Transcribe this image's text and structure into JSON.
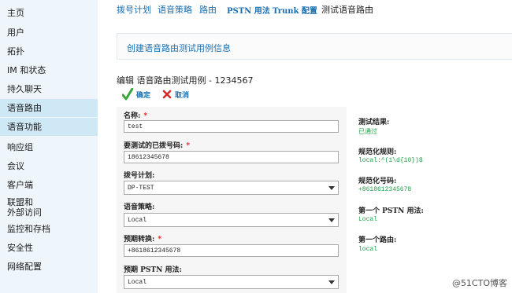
{
  "sidebar": {
    "items": [
      {
        "label": "主页"
      },
      {
        "label": "用户"
      },
      {
        "label": "拓扑"
      },
      {
        "label": "IM 和状态"
      },
      {
        "label": "持久聊天"
      },
      {
        "label": "语音路由"
      },
      {
        "label": "语音功能"
      },
      {
        "label": "响应组"
      },
      {
        "label": "会议"
      },
      {
        "label": "客户端"
      },
      {
        "label": "联盟和",
        "label2": "外部访问"
      },
      {
        "label": "监控和存档"
      },
      {
        "label": "安全性"
      },
      {
        "label": "网络配置"
      }
    ]
  },
  "tabs": [
    {
      "label": "拨号计划"
    },
    {
      "label": "语音策略"
    },
    {
      "label": "路由"
    },
    {
      "label": "PSTN 用法"
    },
    {
      "label": "Trunk 配置"
    },
    {
      "label": "测试语音路由"
    }
  ],
  "info_box": {
    "link": "创建语音路由测试用例信息"
  },
  "edit_title": "编辑 语音路由测试用例 - 1234567",
  "actions": {
    "ok": "确定",
    "cancel": "取消"
  },
  "form": {
    "name": {
      "label": "名称:",
      "required": "*",
      "value": "test"
    },
    "number": {
      "label": "要测试的已拨号码:",
      "required": "*",
      "value": "18612345678"
    },
    "dial_plan": {
      "label": "拨号计划:",
      "value": "DP-TEST"
    },
    "voice_policy": {
      "label": "语音策略:",
      "value": "Local"
    },
    "expected_translation": {
      "label": "预期转换:",
      "required": "*",
      "value": "+8618612345678"
    },
    "expected_pstn": {
      "label": "预期 PSTN 用法:",
      "value": "Local"
    }
  },
  "results": {
    "test_result": {
      "label": "测试结果:",
      "value": "已通过"
    },
    "normalization_rule": {
      "label": "规范化规则:",
      "value": "local:^(1\\d{10})$"
    },
    "normalized_number": {
      "label": "规范化号码:",
      "value": "+8618612345678"
    },
    "first_pstn": {
      "label": "第一个 PSTN 用法:",
      "value": "Local"
    },
    "first_route": {
      "label": "第一个路由:",
      "value": "local"
    }
  },
  "watermark": "@51CTO博客",
  "colors": {
    "accent": "#1a6fb0",
    "success": "#22a04a",
    "required": "#e02020",
    "sidebar_bg": "#eef6fb",
    "sidebar_active": "#cfe8f6"
  }
}
